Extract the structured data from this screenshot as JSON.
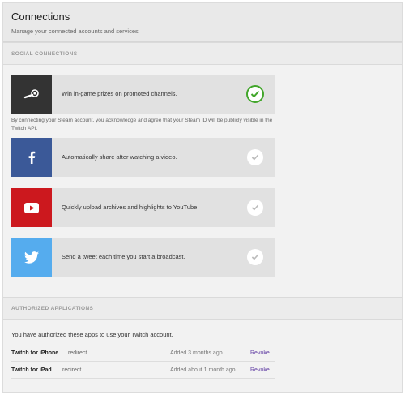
{
  "header": {
    "title": "Connections",
    "subtitle": "Manage your connected accounts and services"
  },
  "social": {
    "section_title": "SOCIAL CONNECTIONS",
    "connections": [
      {
        "service": "steam",
        "label": "Win in-game prizes on promoted channels.",
        "connected": true,
        "color": "#333333",
        "icon": "steam-icon"
      },
      {
        "service": "facebook",
        "label": "Automatically share after watching a video.",
        "connected": false,
        "color": "#3b5998",
        "icon": "facebook-icon"
      },
      {
        "service": "youtube",
        "label": "Quickly upload archives and highlights to YouTube.",
        "connected": false,
        "color": "#cc181e",
        "icon": "youtube-icon"
      },
      {
        "service": "twitter",
        "label": "Send a tweet each time you start a broadcast.",
        "connected": false,
        "color": "#55acee",
        "icon": "twitter-icon"
      }
    ],
    "steam_note": "By connecting your Steam account, you acknowledge and agree that your Steam ID will be publicly visible in the Twitch API."
  },
  "apps": {
    "section_title": "AUTHORIZED APPLICATIONS",
    "intro": "You have authorized these apps to use your Twitch account.",
    "items": [
      {
        "name": "Twitch for iPhone",
        "type": "redirect",
        "added": "Added 3 months ago",
        "action": "Revoke"
      },
      {
        "name": "Twitch for iPad",
        "type": "redirect",
        "added": "Added about 1 month ago",
        "action": "Revoke"
      }
    ]
  },
  "colors": {
    "check_active": "#42a62b",
    "check_inactive": "#bbbbbb",
    "link": "#6441a5"
  }
}
